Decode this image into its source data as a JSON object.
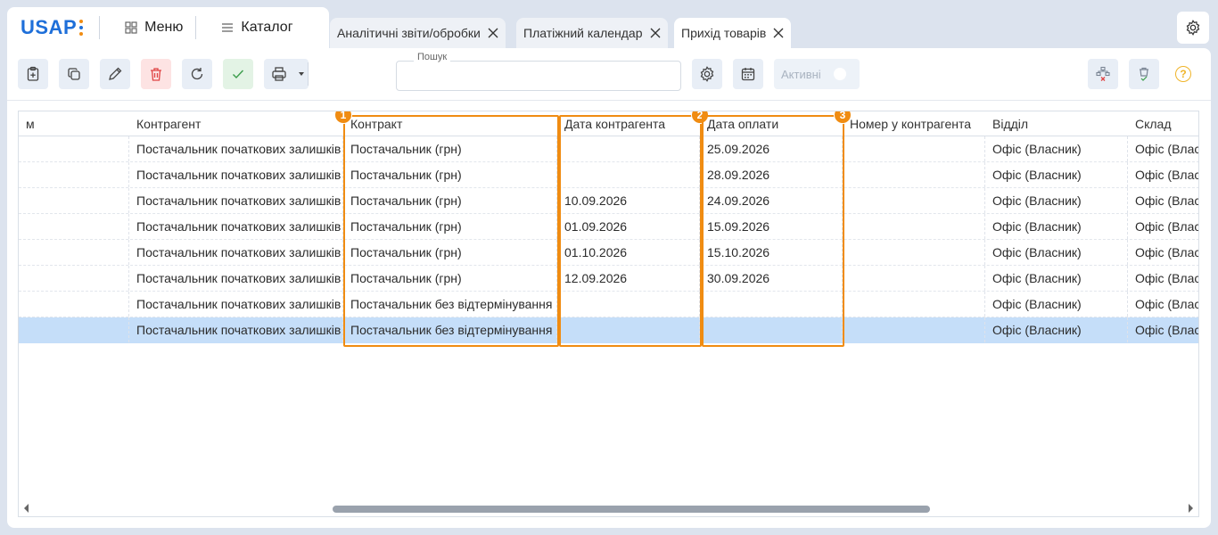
{
  "app": {
    "logo": "USAP",
    "logo_dot_colors": [
      "#f08c12",
      "#1e6fd9",
      "#f08c12"
    ]
  },
  "topnav": {
    "menu_label": "Меню",
    "catalog_label": "Каталог"
  },
  "tabs": [
    {
      "label": "Аналітичні звіти/обробки"
    },
    {
      "label": "Платіжний календар"
    },
    {
      "label": "Прихід товарів"
    }
  ],
  "toolbar": {
    "search_label": "Пошук",
    "search_value": "",
    "active_label": "Активні"
  },
  "table": {
    "columns": [
      "м",
      "Контрагент",
      "Контракт",
      "Дата контрагента",
      "Дата оплати",
      "Номер у контрагента",
      "Відділ",
      "Склад"
    ],
    "rows": [
      [
        "",
        "Постачальник початкових залишків",
        "Постачальник (грн)",
        "",
        "25.09.2026",
        "",
        "Офіс (Власник)",
        "Офіс (Власник)"
      ],
      [
        "",
        "Постачальник початкових залишків",
        "Постачальник (грн)",
        "",
        "28.09.2026",
        "",
        "Офіс (Власник)",
        "Офіс (Власник)"
      ],
      [
        "",
        "Постачальник початкових залишків",
        "Постачальник (грн)",
        "10.09.2026",
        "24.09.2026",
        "",
        "Офіс (Власник)",
        "Офіс (Власник)"
      ],
      [
        "",
        "Постачальник початкових залишків",
        "Постачальник (грн)",
        "01.09.2026",
        "15.09.2026",
        "",
        "Офіс (Власник)",
        "Офіс (Власник)"
      ],
      [
        "",
        "Постачальник початкових залишків",
        "Постачальник (грн)",
        "01.10.2026",
        "15.10.2026",
        "",
        "Офіс (Власник)",
        "Офіс (Власник)"
      ],
      [
        "",
        "Постачальник початкових залишків",
        "Постачальник (грн)",
        "12.09.2026",
        "30.09.2026",
        "",
        "Офіс (Власник)",
        "Офіс (Власник)"
      ],
      [
        "",
        "Постачальник початкових залишків",
        "Постачальник без відтермінування",
        "",
        "",
        "",
        "Офіс (Власник)",
        "Офіс (Власник)"
      ],
      [
        "",
        "Постачальник початкових залишків",
        "Постачальник без відтермінування",
        "",
        "",
        "",
        "Офіс (Власник)",
        "Офіс (Власник)"
      ]
    ],
    "selected_row": 7
  },
  "annotations": [
    "1",
    "2",
    "3"
  ],
  "colors": {
    "accent": "#1e6fd9",
    "highlight": "#f08c12",
    "selected_row": "#c5def9"
  }
}
